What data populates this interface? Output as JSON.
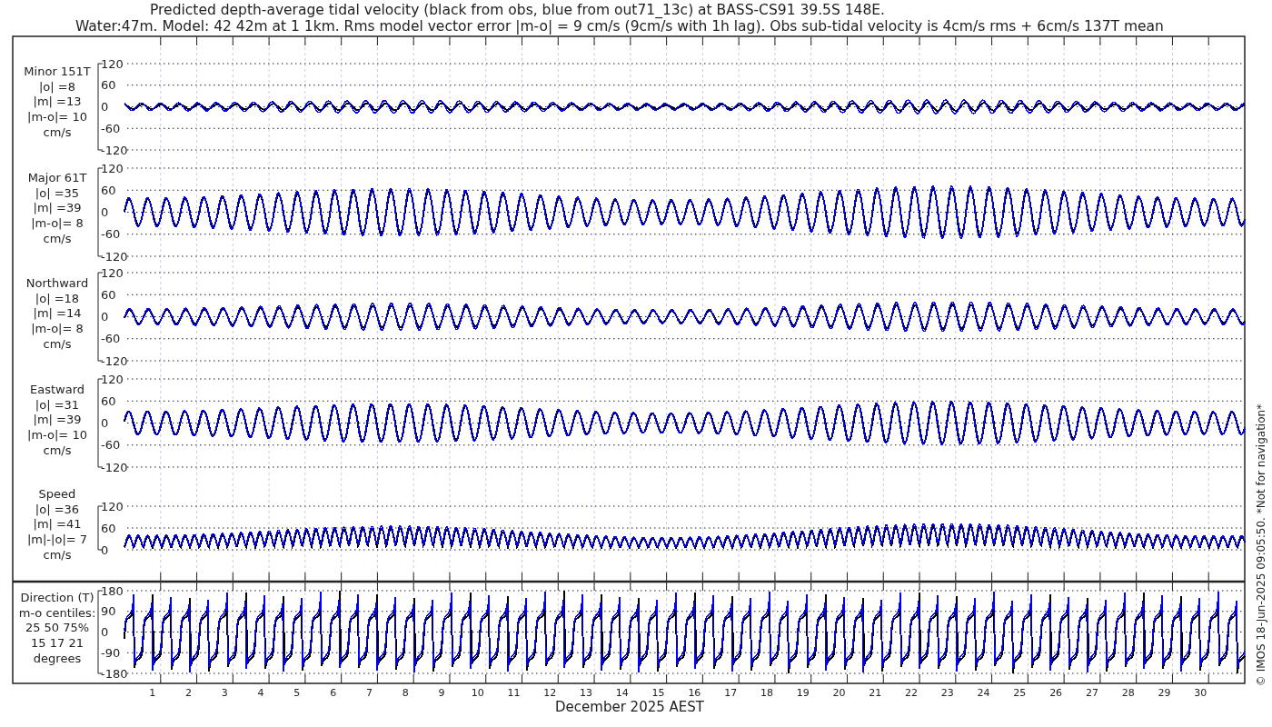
{
  "title": [
    "Predicted depth-average tidal velocity (black from obs, blue from out71_13c) at BASS-CS91 39.5S 148E.",
    "Water:47m. Model: 42 42m at 1 1km. Rms model vector error |m-o| = 9 cm/s (9cm/s with 1h lag). Obs sub-tidal velocity is 4cm/s rms + 6cm/s 137T mean"
  ],
  "traces": [
    {
      "color": "#000000"
    },
    {
      "color": "#0000ff"
    }
  ],
  "panels": [
    {
      "kind": "minor",
      "label": [
        "Minor 151T",
        "|o| =8",
        "|m| =13",
        "|m-o|= 10",
        "cm/s"
      ],
      "yticks": [
        "120",
        "60",
        "0",
        "-60",
        "-120"
      ]
    },
    {
      "kind": "major",
      "label": [
        "Major 61T",
        "|o| =35",
        "|m| =39",
        "|m-o|= 8",
        "cm/s"
      ],
      "yticks": [
        "120",
        "60",
        "0",
        "-60",
        "-120"
      ]
    },
    {
      "kind": "north",
      "label": [
        "Northward",
        "|o| =18",
        "|m| =14",
        "|m-o|= 8",
        "cm/s"
      ],
      "yticks": [
        "120",
        "60",
        "0",
        "-60",
        "-120"
      ]
    },
    {
      "kind": "east",
      "label": [
        "Eastward",
        "|o| =31",
        "|m| =39",
        "|m-o|= 10",
        "cm/s"
      ],
      "yticks": [
        "120",
        "60",
        "0",
        "-60",
        "-120"
      ]
    },
    {
      "kind": "speed",
      "label": [
        "Speed",
        "|o| =36",
        "|m| =41",
        "|m|-|o|= 7",
        "cm/s"
      ],
      "yticks": [
        "120",
        "60",
        "0"
      ]
    },
    {
      "kind": "direction",
      "label": [
        "Direction (T)",
        "m-o centiles:",
        "25  50  75%",
        "15  17  21",
        "degrees"
      ],
      "yticks": [
        "180",
        "90",
        "0",
        "-90",
        "-180"
      ]
    }
  ],
  "days": [
    "1",
    "2",
    "3",
    "4",
    "5",
    "6",
    "7",
    "8",
    "9",
    "10",
    "11",
    "12",
    "13",
    "14",
    "15",
    "16",
    "17",
    "18",
    "19",
    "20",
    "21",
    "22",
    "23",
    "24",
    "25",
    "26",
    "27",
    "28",
    "29",
    "30"
  ],
  "xlabel": "December 2025 AEST",
  "footer": "© IMOS 18-Jun-2025 09:05:50. *Not for navigation*"
}
